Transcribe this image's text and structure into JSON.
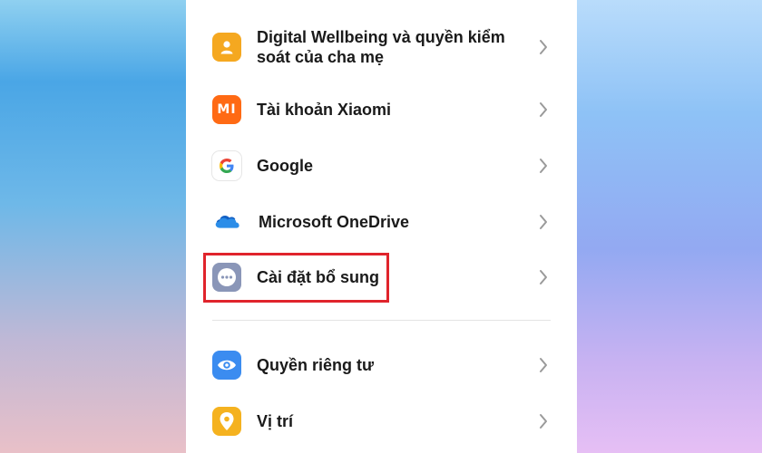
{
  "colors": {
    "wellbeing_icon": "#f5a820",
    "xiaomi_icon": "#ff6a14",
    "google_icon_bg": "#ffffff",
    "onedrive_icon": "#1e73d6",
    "additional_settings_icon": "#8a96b8",
    "privacy_icon": "#3b8cf0",
    "location_icon": "#f5b21f",
    "highlight_border": "#e0242c"
  },
  "settings": {
    "items": [
      {
        "label": "Digital Wellbeing và quyền kiểm soát của cha mẹ",
        "icon": "person-icon"
      },
      {
        "label": "Tài khoản Xiaomi",
        "icon": "xiaomi-mi-icon"
      },
      {
        "label": "Google",
        "icon": "google-g-icon"
      },
      {
        "label": "Microsoft OneDrive",
        "icon": "onedrive-cloud-icon"
      },
      {
        "label": "Cài đặt bổ sung",
        "icon": "more-dots-icon"
      },
      {
        "label": "Quyền riêng tư",
        "icon": "eye-icon"
      },
      {
        "label": "Vị trí",
        "icon": "location-pin-icon"
      }
    ],
    "xiaomi_icon_text": "MI"
  }
}
